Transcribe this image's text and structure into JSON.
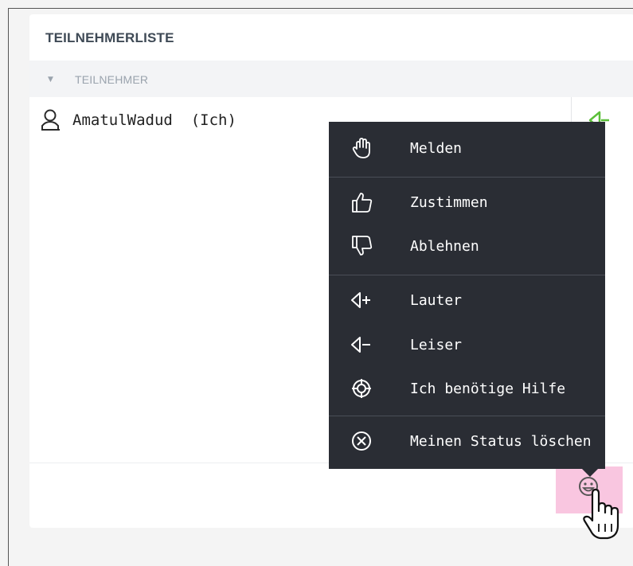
{
  "panel": {
    "title": "TEILNEHMERLISTE",
    "section_label": "TEILNEHMER",
    "section_caret_icon": "caret-down-icon"
  },
  "participants": [
    {
      "name": "AmatulWadud  (Ich)",
      "icon": "user-icon",
      "status_icon": "volume-down-icon"
    }
  ],
  "status_menu": {
    "items": [
      {
        "label": "Melden",
        "icon": "raise-hand-icon"
      },
      {
        "label": "Zustimmen",
        "icon": "thumbs-up-icon"
      },
      {
        "label": "Ablehnen",
        "icon": "thumbs-down-icon"
      },
      {
        "label": "Lauter",
        "icon": "volume-up-icon"
      },
      {
        "label": "Leiser",
        "icon": "volume-down-icon"
      },
      {
        "label": "Ich benötige Hilfe",
        "icon": "lifebuoy-icon"
      },
      {
        "label": "Meinen Status löschen",
        "icon": "clear-status-icon"
      }
    ]
  },
  "status_button": {
    "icon": "smiley-icon",
    "highlight_color": "#f9c6e0"
  },
  "colors": {
    "menu_bg": "#2a2d34",
    "status_green": "#5cbf3a",
    "title_text": "#3f4a56"
  }
}
